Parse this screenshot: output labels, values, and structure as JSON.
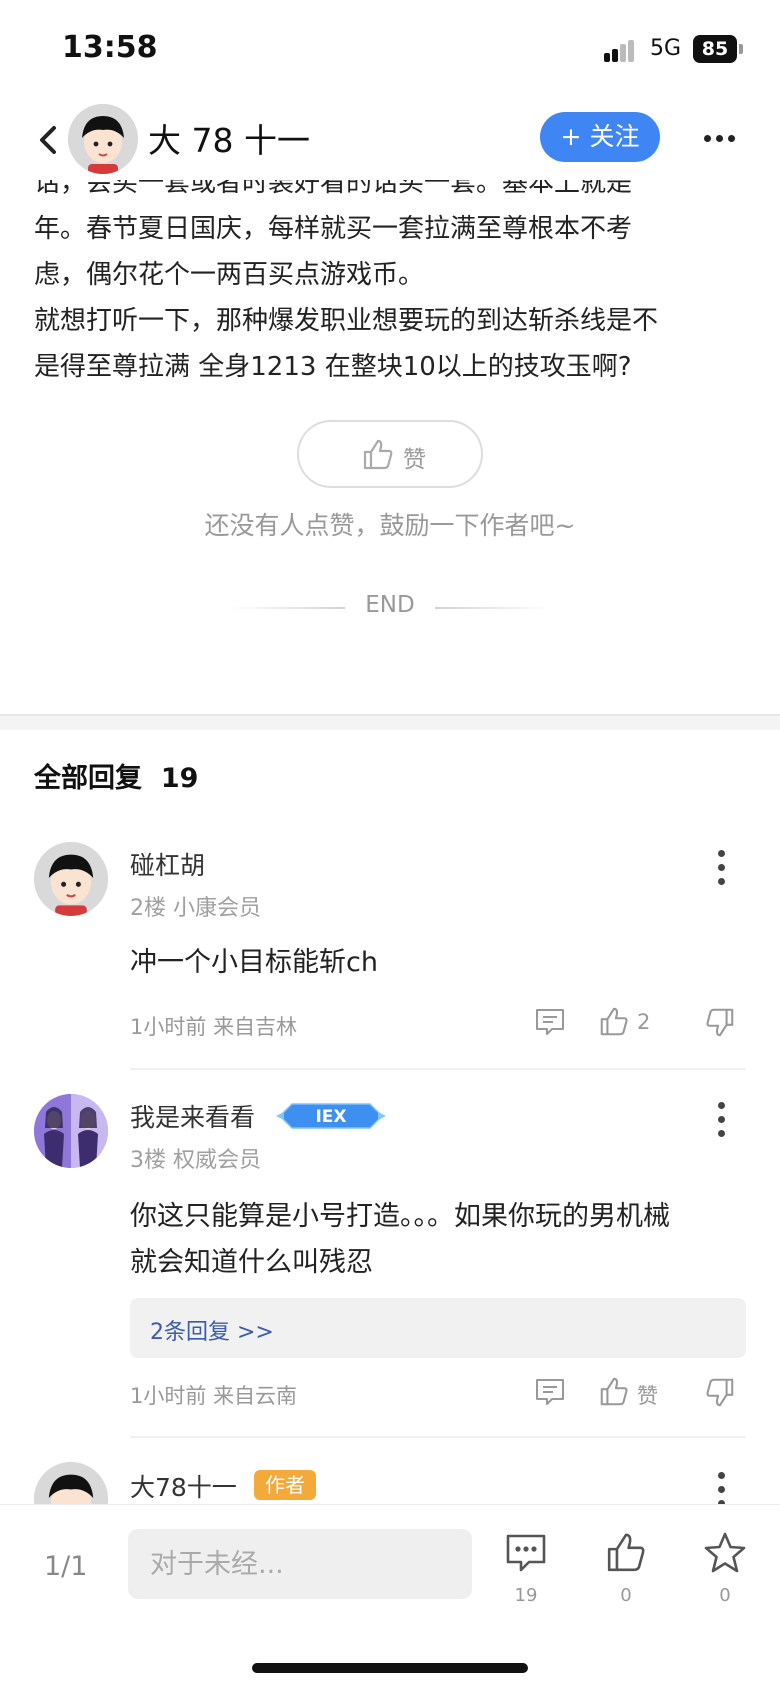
{
  "status_bar": {
    "time": "13:58",
    "network": "5G",
    "battery": "85"
  },
  "header": {
    "author_name": "大 78 十一",
    "follow_label": "+ 关注"
  },
  "post": {
    "lines": [
      "话，会买一套或者时装好看的话买一套。基本上就是",
      "年。春节夏日国庆，每样就买一套拉满至尊根本不考",
      "虑，偶尔花个一两百买点游戏币。",
      "就想打听一下，那种爆发职业想要玩的到达斩杀线是不",
      "是得至尊拉满 全身1213 在整块10以上的技攻玉啊?"
    ],
    "like_label": "赞",
    "like_hint": "还没有人点赞，鼓励一下作者吧~",
    "end_label": "END"
  },
  "replies_header": {
    "label": "全部回复",
    "count": "19"
  },
  "replies": [
    {
      "name": "碰杠胡",
      "floor": "2楼",
      "level": "小康会员",
      "text_lines": [
        "冲一个小目标能斩ch"
      ],
      "time": "1小时前",
      "location": "来自吉林",
      "likes": "2"
    },
    {
      "name": "我是来看看",
      "badge": "IEX",
      "floor": "3楼",
      "level": "权威会员",
      "text_lines": [
        "你这只能算是小号打造。。。如果你玩的男机械",
        "就会知道什么叫残忍"
      ],
      "sub_replies": "2条回复 >>",
      "time": "1小时前",
      "location": "来自云南",
      "likes": "赞"
    },
    {
      "name": "大78十一",
      "badge": "作者"
    }
  ],
  "bottom_bar": {
    "page_indicator": "1/1",
    "input_placeholder": "对于未经...",
    "comment_count": "19",
    "like_count": "0",
    "favorite_count": "0"
  },
  "colors": {
    "accent_blue": "#3f86f4",
    "author_badge": "#f4a93b",
    "link_blue": "#3b5ca8"
  },
  "icons": [
    "back-chevron-icon",
    "more-dots-icon",
    "thumbs-up-icon",
    "thumbs-down-icon",
    "comment-icon",
    "star-icon"
  ]
}
